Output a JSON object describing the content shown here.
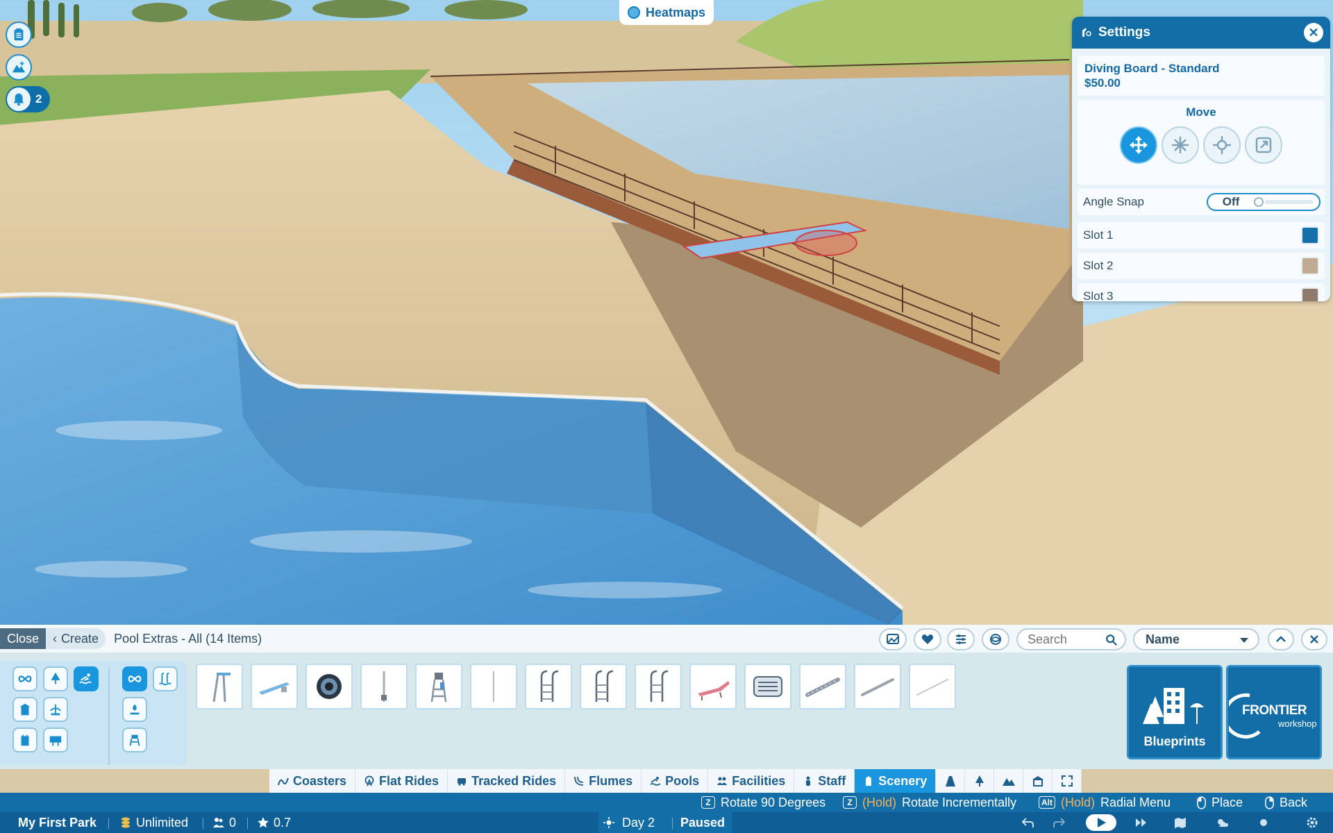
{
  "hud": {
    "heatmaps_label": "Heatmaps",
    "notification_count": "2",
    "icons": [
      "clipboard-icon",
      "terrain-icon",
      "bell-icon"
    ]
  },
  "settings": {
    "title": "Settings",
    "item_name": "Diving Board - Standard",
    "item_price": "$50.00",
    "move_label": "Move",
    "move_modes": [
      "move-arrows-icon",
      "freeze-icon",
      "position-icon",
      "scale-icon"
    ],
    "angle_snap_label": "Angle Snap",
    "angle_snap_value": "Off",
    "slots": [
      {
        "label": "Slot 1",
        "color": "#1470a8"
      },
      {
        "label": "Slot 2",
        "color": "#c1aa94"
      },
      {
        "label": "Slot 3",
        "color": "#8f7a6c"
      }
    ]
  },
  "build_panel": {
    "close_label": "Close",
    "create_label": "Create",
    "title": "Pool Extras - All (14 Items)",
    "search_placeholder": "Search",
    "sort_value": "Name",
    "items": [
      "diving-tower",
      "diving-board",
      "pool-light",
      "pool-rail",
      "lifeguard-chair",
      "pole",
      "pool-ladder-1",
      "pool-ladder-2",
      "pool-ladder-3",
      "sun-lounger",
      "pool-filter",
      "pool-pipe-1",
      "pool-pipe-2",
      "pool-pipe-3"
    ],
    "blueprints_label": "Blueprints",
    "workshop_brand": "FRONTIER",
    "workshop_sub": "workshop"
  },
  "tabs": [
    {
      "label": "Coasters",
      "active": false
    },
    {
      "label": "Flat Rides",
      "active": false
    },
    {
      "label": "Tracked Rides",
      "active": false
    },
    {
      "label": "Flumes",
      "active": false
    },
    {
      "label": "Pools",
      "active": false
    },
    {
      "label": "Facilities",
      "active": false
    },
    {
      "label": "Staff",
      "active": false
    },
    {
      "label": "Scenery",
      "active": true
    }
  ],
  "hints": {
    "rotate90_key": "Z",
    "rotate90_label": "Rotate 90 Degrees",
    "rotate_inc_key": "Z",
    "rotate_inc_hold": "(Hold)",
    "rotate_inc_label": "Rotate Incrementally",
    "radial_key": "Alt",
    "radial_hold": "(Hold)",
    "radial_label": "Radial Menu",
    "place_label": "Place",
    "back_label": "Back"
  },
  "status": {
    "park_name": "My First Park",
    "money": "Unlimited",
    "guests": "0",
    "rating": "0.7",
    "day": "Day 2",
    "state": "Paused"
  },
  "colors": {
    "accent": "#1a96de",
    "panel_blue": "#136ea8",
    "status_blue": "#0f5f96"
  }
}
